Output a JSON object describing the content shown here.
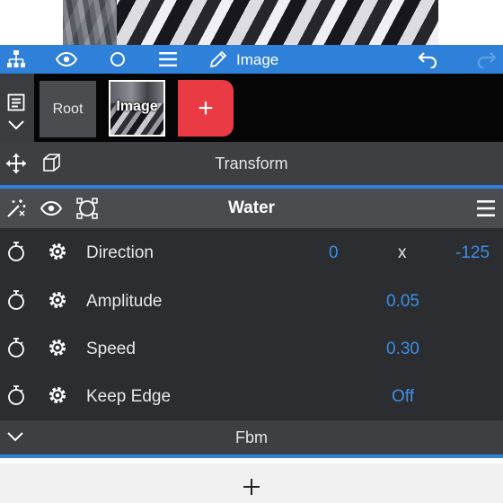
{
  "toolbar": {
    "active_layer_label": "Image",
    "icons": [
      "hierarchy-icon",
      "eye-icon",
      "circle-icon",
      "menu-icon",
      "pencil-icon",
      "undo-icon",
      "redo-icon"
    ]
  },
  "layers": {
    "items": [
      {
        "label": "Root"
      },
      {
        "label": "Image"
      }
    ],
    "add_label": "+"
  },
  "transform": {
    "title": "Transform"
  },
  "effect": {
    "title": "Water",
    "params": [
      {
        "label": "Direction",
        "value1": "0",
        "separator": "x",
        "value2": "-125"
      },
      {
        "label": "Amplitude",
        "value": "0.05"
      },
      {
        "label": "Speed",
        "value": "0.30"
      },
      {
        "label": "Keep Edge",
        "value": "Off"
      }
    ]
  },
  "fbm": {
    "title": "Fbm"
  },
  "colors": {
    "accent": "#2f80d8",
    "value_blue": "#3d8ee8",
    "add_red": "#ea3a44"
  }
}
